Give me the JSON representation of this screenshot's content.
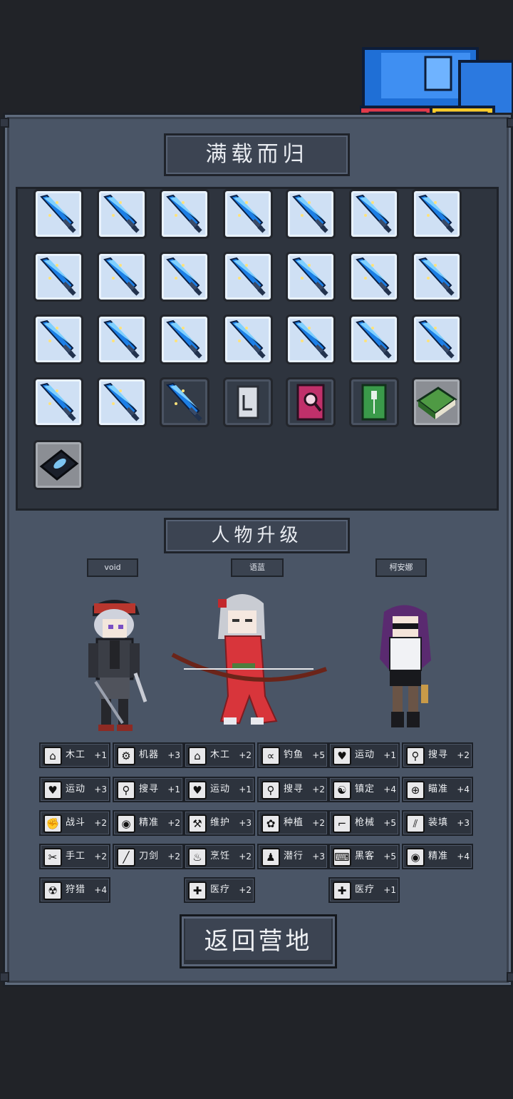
{
  "loot": {
    "title": "满载而归",
    "items": [
      {
        "icon": "ice-sword-icon",
        "style": "blue"
      },
      {
        "icon": "ice-sword-icon",
        "style": "blue"
      },
      {
        "icon": "ice-sword-icon",
        "style": "blue"
      },
      {
        "icon": "ice-sword-icon",
        "style": "blue"
      },
      {
        "icon": "ice-sword-icon",
        "style": "blue"
      },
      {
        "icon": "ice-sword-icon",
        "style": "blue"
      },
      {
        "icon": "ice-sword-icon",
        "style": "blue"
      },
      {
        "icon": "ice-sword-icon",
        "style": "blue"
      },
      {
        "icon": "ice-sword-icon",
        "style": "blue"
      },
      {
        "icon": "ice-sword-icon",
        "style": "blue"
      },
      {
        "icon": "ice-sword-icon",
        "style": "blue"
      },
      {
        "icon": "ice-sword-icon",
        "style": "blue"
      },
      {
        "icon": "ice-sword-icon",
        "style": "blue"
      },
      {
        "icon": "ice-sword-icon",
        "style": "blue"
      },
      {
        "icon": "ice-sword-icon",
        "style": "blue"
      },
      {
        "icon": "ice-sword-icon",
        "style": "blue"
      },
      {
        "icon": "ice-sword-icon",
        "style": "blue"
      },
      {
        "icon": "ice-sword-icon",
        "style": "blue"
      },
      {
        "icon": "ice-sword-icon",
        "style": "blue"
      },
      {
        "icon": "ice-sword-icon",
        "style": "blue"
      },
      {
        "icon": "ice-sword-icon",
        "style": "blue"
      },
      {
        "icon": "ice-sword-icon",
        "style": "blue"
      },
      {
        "icon": "ice-sword-icon",
        "style": "blue"
      },
      {
        "icon": "ice-sword-icon",
        "style": "dark"
      },
      {
        "icon": "grey-book-icon",
        "style": "dark"
      },
      {
        "icon": "pink-magnifier-book-icon",
        "style": "dark"
      },
      {
        "icon": "green-book-icon",
        "style": "dark"
      },
      {
        "icon": "green-skill-book-icon",
        "style": "gray"
      },
      {
        "icon": "fish-book-icon",
        "style": "gray"
      }
    ]
  },
  "upgrade": {
    "title": "人物升级",
    "characters": [
      {
        "name": "void",
        "sprite": "cap-boy-with-crowbar",
        "skills": [
          {
            "icon": "house-icon",
            "name": "木工",
            "level": "+1"
          },
          {
            "icon": "gear-icon",
            "name": "机器",
            "level": "+3"
          },
          {
            "icon": "heart-icon",
            "name": "运动",
            "level": "+3"
          },
          {
            "icon": "magnifier-icon",
            "name": "搜寻",
            "level": "+1"
          },
          {
            "icon": "fist-icon",
            "name": "战斗",
            "level": "+2"
          },
          {
            "icon": "eye-icon",
            "name": "精准",
            "level": "+2"
          },
          {
            "icon": "scissors-icon",
            "name": "手工",
            "level": "+2"
          },
          {
            "icon": "sword-icon",
            "name": "刀剑",
            "level": "+2"
          },
          {
            "icon": "radiation-icon",
            "name": "狩猎",
            "level": "+4"
          }
        ]
      },
      {
        "name": "语蓝",
        "sprite": "archer-girl-red-kimono",
        "skills": [
          {
            "icon": "house-icon",
            "name": "木工",
            "level": "+2"
          },
          {
            "icon": "fish-icon",
            "name": "钓鱼",
            "level": "+5"
          },
          {
            "icon": "heart-icon",
            "name": "运动",
            "level": "+1"
          },
          {
            "icon": "magnifier-icon",
            "name": "搜寻",
            "level": "+2"
          },
          {
            "icon": "wrench-icon",
            "name": "维护",
            "level": "+3"
          },
          {
            "icon": "plant-icon",
            "name": "种植",
            "level": "+2"
          },
          {
            "icon": "pot-icon",
            "name": "烹饪",
            "level": "+2"
          },
          {
            "icon": "sneak-icon",
            "name": "潜行",
            "level": "+3"
          },
          {
            "icon": "medkit-icon",
            "name": "医疗",
            "level": "+2"
          }
        ]
      },
      {
        "name": "柯安娜",
        "sprite": "woman-with-sunglasses-and-pistol",
        "skills": [
          {
            "icon": "heart-icon",
            "name": "运动",
            "level": "+1"
          },
          {
            "icon": "magnifier-icon",
            "name": "搜寻",
            "level": "+2"
          },
          {
            "icon": "calm-icon",
            "name": "镇定",
            "level": "+4"
          },
          {
            "icon": "crosshair-icon",
            "name": "瞄准",
            "level": "+4"
          },
          {
            "icon": "gun-icon",
            "name": "枪械",
            "level": "+5"
          },
          {
            "icon": "reload-icon",
            "name": "装填",
            "level": "+3"
          },
          {
            "icon": "hacker-icon",
            "name": "黑客",
            "level": "+5"
          },
          {
            "icon": "eye-icon",
            "name": "精准",
            "level": "+4"
          },
          {
            "icon": "medkit-icon",
            "name": "医疗",
            "level": "+1"
          }
        ]
      }
    ]
  },
  "return_button": "返回营地"
}
